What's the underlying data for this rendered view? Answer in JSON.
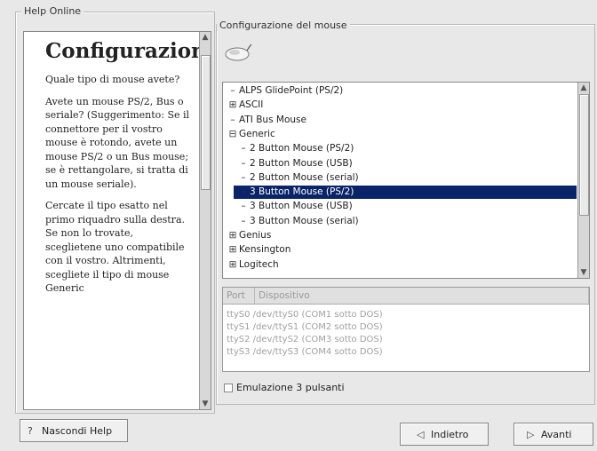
{
  "help_panel": {
    "group_title": "Help Online",
    "title": "Configurazione del mouse",
    "paragraphs": [
      "Quale tipo di mouse avete?",
      "Avete un mouse PS/2, Bus o seriale? (Suggerimento: Se il connettore per il vostro mouse è rotondo, avete un mouse PS/2 o un Bus mouse; se è rettangolare, si tratta di un mouse seriale).",
      "Cercate il tipo esatto nel primo riquadro sulla destra. Se non lo trovate, sceglietene uno compatibile con il vostro. Altrimenti, scegliete il tipo di mouse Generic"
    ]
  },
  "mouse_config": {
    "group_title": "Configurazione del mouse",
    "tree": [
      {
        "label": "ALPS GlidePoint (PS/2)",
        "level": 0,
        "glyph": "–"
      },
      {
        "label": "ASCII",
        "level": 0,
        "glyph": "⊞"
      },
      {
        "label": "ATI Bus Mouse",
        "level": 0,
        "glyph": "–"
      },
      {
        "label": "Generic",
        "level": 0,
        "glyph": "⊟"
      },
      {
        "label": "2 Button Mouse (PS/2)",
        "level": 1,
        "glyph": "–"
      },
      {
        "label": "2 Button Mouse (USB)",
        "level": 1,
        "glyph": "–"
      },
      {
        "label": "2 Button Mouse (serial)",
        "level": 1,
        "glyph": "–"
      },
      {
        "label": "3 Button Mouse (PS/2)",
        "level": 1,
        "glyph": "–",
        "selected": true
      },
      {
        "label": "3 Button Mouse (USB)",
        "level": 1,
        "glyph": "–"
      },
      {
        "label": "3 Button Mouse (serial)",
        "level": 1,
        "glyph": "–"
      },
      {
        "label": "Genius",
        "level": 0,
        "glyph": "⊞"
      },
      {
        "label": "Kensington",
        "level": 0,
        "glyph": "⊞"
      },
      {
        "label": "Logitech",
        "level": 0,
        "glyph": "⊞"
      }
    ],
    "device_table": {
      "columns": [
        "Port",
        "Dispositivo"
      ],
      "rows": [
        "ttyS0  /dev/ttyS0  (COM1 sotto DOS)",
        "ttyS1  /dev/ttyS1  (COM2 sotto DOS)",
        "ttyS2  /dev/ttyS2  (COM3 sotto DOS)",
        "ttyS3  /dev/ttyS3  (COM4 sotto DOS)"
      ]
    },
    "emulation_label": "Emulazione 3 pulsanti",
    "emulation_checked": false
  },
  "buttons": {
    "hide_help": "Nascondi Help",
    "back": "Indietro",
    "next": "Avanti"
  },
  "colors": {
    "selection": "#0a246a",
    "background": "#e8e8e8"
  }
}
